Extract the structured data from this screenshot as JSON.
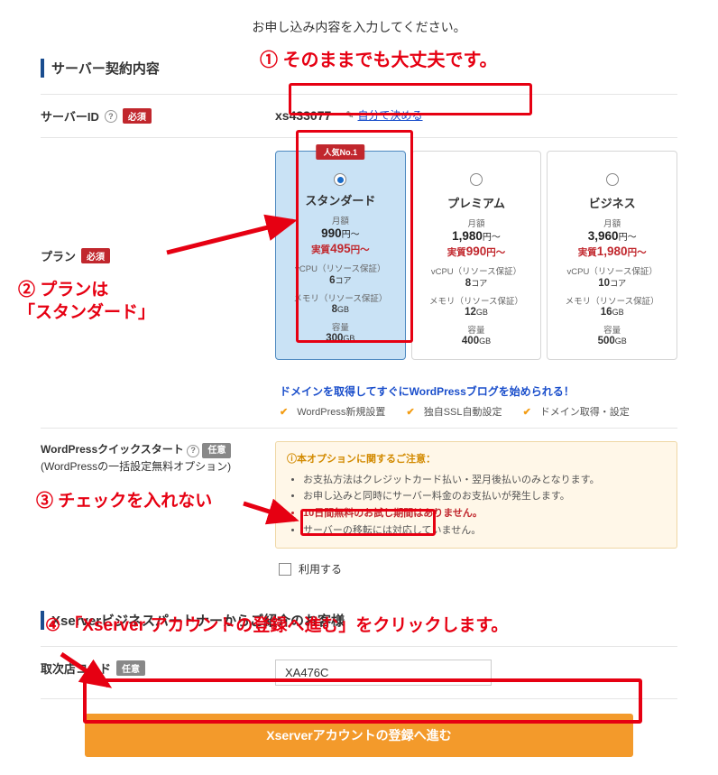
{
  "instruction": "お申し込み内容を入力してください。",
  "section1_title": "サーバー契約内容",
  "badges": {
    "required": "必須",
    "optional": "任意"
  },
  "server_id": {
    "label": "サーバーID",
    "value": "xs433077",
    "link_text": "自分で決める"
  },
  "plan": {
    "label": "プラン",
    "ribbon": "人気No.1",
    "monthly_label": "月額",
    "cpu_label": "vCPU（リソース保証）",
    "mem_label": "メモリ（リソース保証）",
    "cap_label": "容量",
    "cards": [
      {
        "name": "スタンダード",
        "price": "990",
        "price_suffix": "円～",
        "real_prefix": "実質",
        "real": "495",
        "real_suffix": "円～",
        "cpu": "6",
        "cpu_unit": "コア",
        "mem": "8",
        "mem_unit": "GB",
        "cap": "300",
        "cap_unit": "GB"
      },
      {
        "name": "プレミアム",
        "price": "1,980",
        "price_suffix": "円～",
        "real_prefix": "実質",
        "real": "990",
        "real_suffix": "円～",
        "cpu": "8",
        "cpu_unit": "コア",
        "mem": "12",
        "mem_unit": "GB",
        "cap": "400",
        "cap_unit": "GB"
      },
      {
        "name": "ビジネス",
        "price": "3,960",
        "price_suffix": "円～",
        "real_prefix": "実質",
        "real": "1,980",
        "real_suffix": "円～",
        "cpu": "10",
        "cpu_unit": "コア",
        "mem": "16",
        "mem_unit": "GB",
        "cap": "500",
        "cap_unit": "GB"
      }
    ]
  },
  "wp_promo": "ドメインを取得してすぐにWordPressブログを始められる！",
  "wp_features": [
    "WordPress新規設置",
    "独自SSL自動設定",
    "ドメイン取得・設定"
  ],
  "wp_quickstart": {
    "label_main": "WordPressクイックスタート",
    "label_sub": "(WordPressの一括設定無料オプション)",
    "note_title": "本オプションに関するご注意：",
    "notes": [
      "お支払方法はクレジットカード払い・翌月後払いのみとなります。",
      "お申し込みと同時にサーバー料金のお支払いが発生します。",
      "10日間無料のお試し期間はありません。",
      "サーバーの移転には対応していません。"
    ],
    "use_label": "利用する"
  },
  "section2_title": "Xserverビジネスパートナーからご紹介のお客様",
  "agency": {
    "label": "取次店コード",
    "value": "XA476C"
  },
  "submit_label": "Xserverアカウントの登録へ進む",
  "annotations": {
    "a1": "① そのままでも大丈夫です。",
    "a2_l1": "② プランは",
    "a2_l2": "「スタンダード」",
    "a3": "③ チェックを入れない",
    "a4": "④ 「Xserver アカウントの登録へ進む」をクリックします。"
  }
}
